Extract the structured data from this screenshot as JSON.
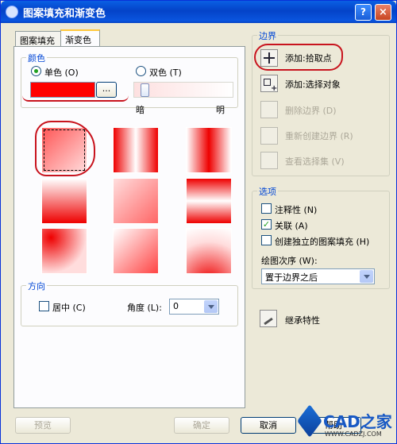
{
  "window": {
    "title": "图案填充和渐变色",
    "help": "?",
    "close": "×"
  },
  "tabs": [
    {
      "label": "图案填充"
    },
    {
      "label": "渐变色"
    }
  ],
  "color": {
    "group_label": "颜色",
    "single": "单色 (O)",
    "double": "双色 (T)",
    "browse": "...",
    "swatch_color": "#ff0000",
    "dark": "暗",
    "light": "明"
  },
  "orientation": {
    "group_label": "方向",
    "center": "居中 (C)",
    "angle_label": "角度 (L):",
    "angle_value": "0"
  },
  "boundary": {
    "group_label": "边界",
    "add_pick": "添加:拾取点",
    "add_select": "添加:选择对象",
    "remove": "删除边界 (D)",
    "recreate": "重新创建边界 (R)",
    "view": "查看选择集 (V)"
  },
  "options": {
    "group_label": "选项",
    "annotative": "注释性 (N)",
    "associative": "关联 (A)",
    "separate": "创建独立的图案填充 (H)",
    "draw_order_label": "绘图次序 (W):",
    "draw_order_value": "置于边界之后"
  },
  "inherit": "继承特性",
  "footer": {
    "preview": "预览",
    "ok": "确定",
    "cancel": "取消",
    "help": "帮助"
  },
  "watermark": {
    "site": "CAD之家",
    "url": "WWW.CADZJ.COM"
  }
}
